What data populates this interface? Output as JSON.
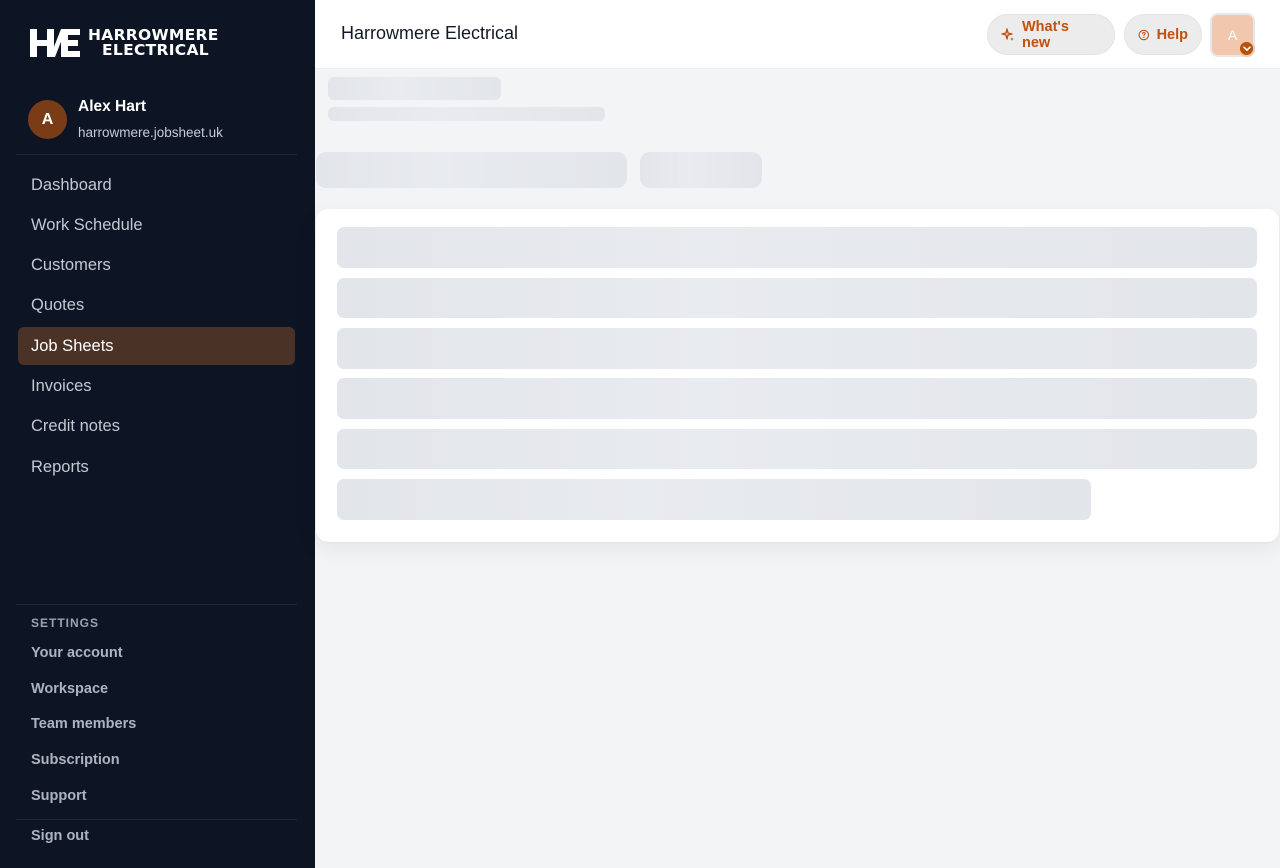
{
  "brand": {
    "line1": "HARROWMERE",
    "line2": "ELECTRICAL",
    "mark": "HE"
  },
  "user": {
    "initial": "A",
    "name": "Alex Hart",
    "domain": "harrowmere.jobsheet.uk"
  },
  "nav": {
    "items": [
      {
        "label": "Dashboard"
      },
      {
        "label": "Work Schedule"
      },
      {
        "label": "Customers"
      },
      {
        "label": "Quotes"
      },
      {
        "label": "Job Sheets",
        "active": true
      },
      {
        "label": "Invoices"
      },
      {
        "label": "Credit notes"
      },
      {
        "label": "Reports"
      }
    ]
  },
  "settings": {
    "title": "SETTINGS",
    "items": [
      {
        "label": "Your account"
      },
      {
        "label": "Workspace"
      },
      {
        "label": "Team members"
      },
      {
        "label": "Subscription"
      },
      {
        "label": "Support"
      }
    ],
    "signout": "Sign out"
  },
  "header": {
    "title": "Harrowmere Electrical",
    "whats_new": "What's new",
    "whats_new_icon": "sparkle-icon",
    "help": "Help",
    "help_icon": "question-circle-icon",
    "avatar_initial": "A"
  },
  "colors": {
    "sidebar_bg": "#0d1424",
    "active_bg": "#4a3326",
    "accent": "#c2500e",
    "skeleton": "#e2e5ea"
  }
}
